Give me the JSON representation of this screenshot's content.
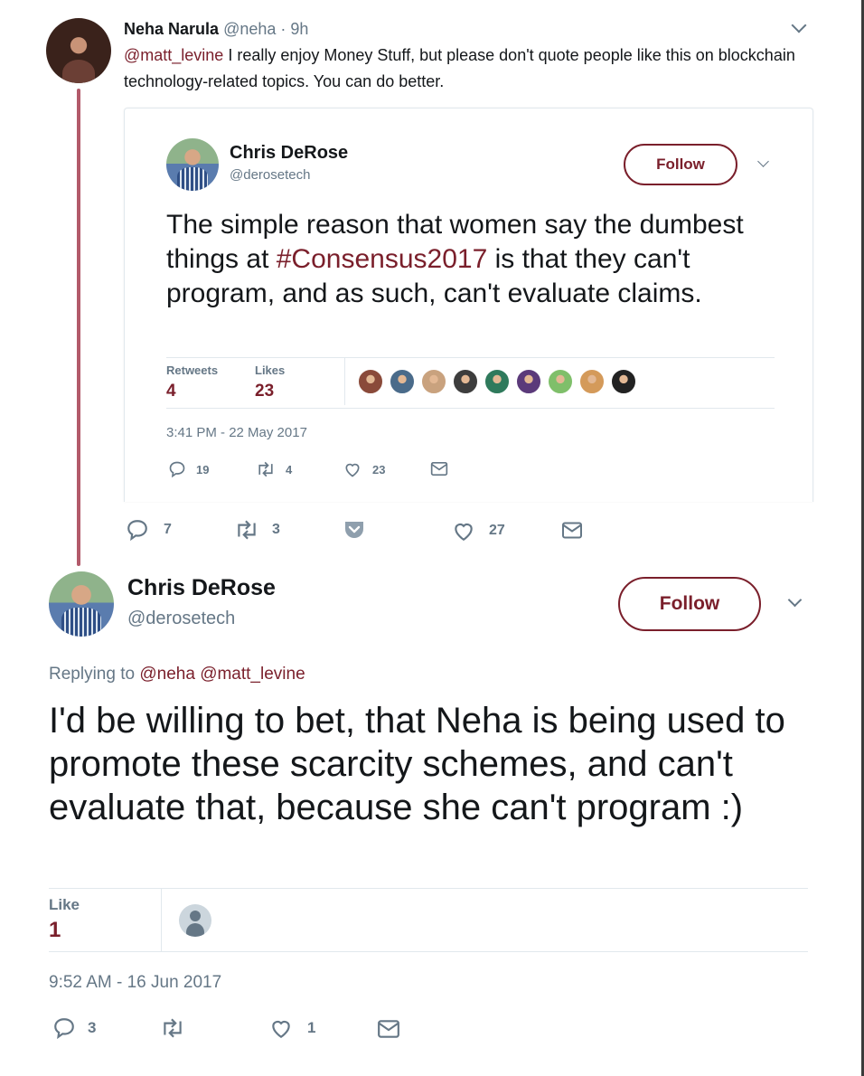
{
  "tweet1": {
    "author_name": "Neha Narula",
    "author_handle": "@neha",
    "separator": "·",
    "time": "9h",
    "mention": "@matt_levine",
    "text": " I really enjoy Money Stuff, but please don't quote people like this on blockchain technology-related topics. You can do better.",
    "actions": {
      "reply_count": "7",
      "retweet_count": "3",
      "like_count": "27"
    }
  },
  "quoted": {
    "author_name": "Chris DeRose",
    "author_handle": "@derosetech",
    "follow_label": "Follow",
    "text_before": "The simple reason that women say the dumbest things at ",
    "hashtag": "#Consensus2017",
    "text_after": " is that they can't program, and as such, can't evaluate claims.",
    "retweets_label": "Retweets",
    "retweets_value": "4",
    "likes_label": "Likes",
    "likes_value": "23",
    "timestamp": "3:41 PM - 22 May 2017",
    "actions": {
      "reply_count": "19",
      "retweet_count": "4",
      "like_count": "23"
    },
    "liker_avatar_colors": [
      "#8a4a3a",
      "#4a6b8a",
      "#c9a27e",
      "#3d3d3d",
      "#2f7a5c",
      "#5b3a7a",
      "#7fbf6a",
      "#d49a5a",
      "#222222"
    ]
  },
  "tweet2": {
    "author_name": "Chris DeRose",
    "author_handle": "@derosetech",
    "follow_label": "Follow",
    "replying_prefix": "Replying to ",
    "replying_mention1": "@neha",
    "replying_mention2": "@matt_levine",
    "text": "I'd be willing to bet, that Neha is being used to promote these scarcity schemes, and can't evaluate that, because she can't program :)",
    "like_label": "Like",
    "like_value": "1",
    "timestamp": "9:52 AM - 16 Jun 2017",
    "actions": {
      "reply_count": "3",
      "like_count": "1"
    }
  },
  "colors": {
    "accent": "#7a1f2b",
    "thread_line": "#b25a6a",
    "muted": "#657786",
    "border": "#e1e8ed"
  }
}
